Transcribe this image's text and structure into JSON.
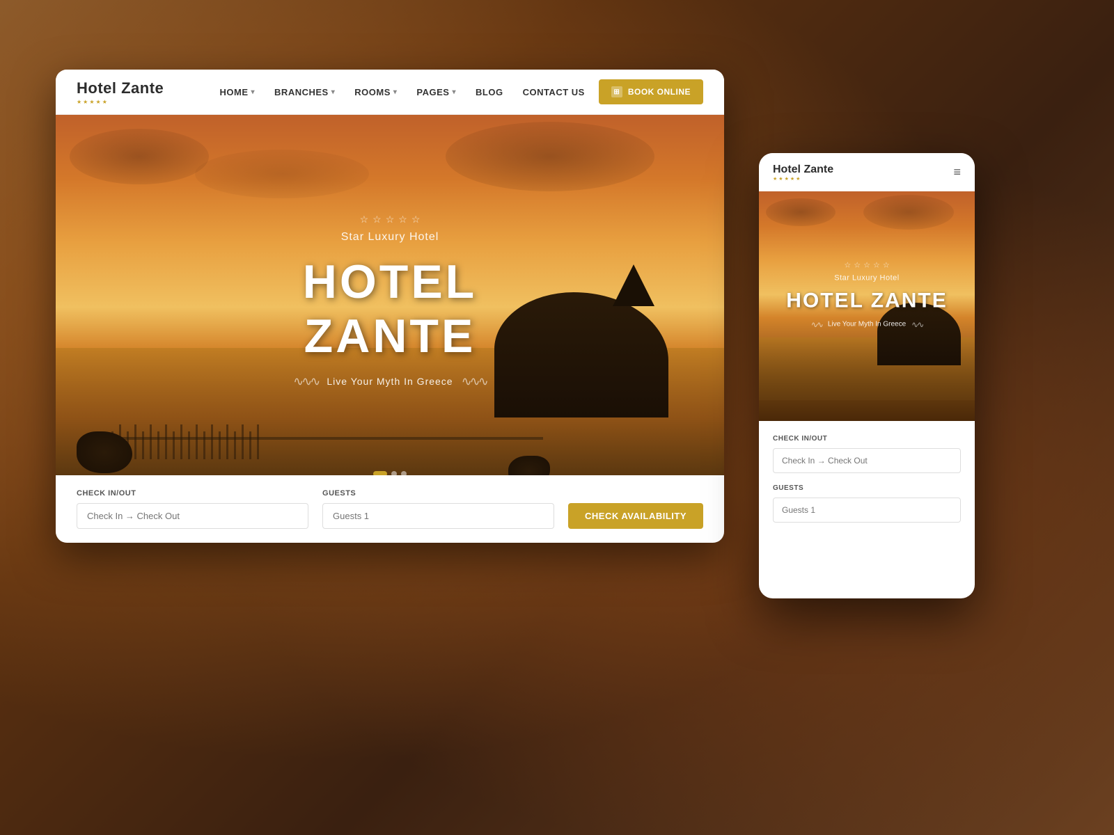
{
  "page": {
    "background_color": "#6b4a2a"
  },
  "desktop": {
    "logo": {
      "name": "Hotel Zante",
      "stars": [
        "★",
        "★",
        "★",
        "★",
        "★"
      ]
    },
    "nav": {
      "links": [
        {
          "label": "HOME",
          "has_dropdown": true
        },
        {
          "label": "BRANCHES",
          "has_dropdown": true
        },
        {
          "label": "ROOMS",
          "has_dropdown": true
        },
        {
          "label": "PAGES",
          "has_dropdown": true
        },
        {
          "label": "BLOG",
          "has_dropdown": false
        },
        {
          "label": "CONTACT US",
          "has_dropdown": false
        }
      ],
      "book_button": "BOOK ONLINE"
    },
    "hero": {
      "stars": [
        "☆",
        "☆",
        "☆",
        "☆",
        "☆"
      ],
      "subtitle": "Star Luxury Hotel",
      "title": "HOTEL ZANTE",
      "tagline": "Live Your Myth In Greece",
      "wave_left": "∿∿∿",
      "wave_right": "∿∿∿"
    },
    "booking": {
      "checkin_label": "Check In/Out",
      "checkin_placeholder": "Check In → Check Out",
      "guests_label": "Guests",
      "guests_placeholder": "Guests 1",
      "button_label": "CHECK AVAILABILITY"
    }
  },
  "mobile": {
    "logo": {
      "name": "Hotel Zante",
      "stars": [
        "★",
        "★",
        "★",
        "★",
        "★"
      ]
    },
    "hamburger": "≡",
    "hero": {
      "stars": [
        "☆",
        "☆",
        "☆",
        "☆",
        "☆"
      ],
      "subtitle": "Star Luxury Hotel",
      "title": "HOTEL ZANTE",
      "tagline": "Live Your Myth In Greece",
      "wave_left": "∿∿",
      "wave_right": "∿∿"
    },
    "booking": {
      "checkin_label": "Check In/Out",
      "checkin_placeholder": "Check In → Check Out",
      "guests_label": "Guests",
      "guests_placeholder": "Guests 1"
    }
  }
}
